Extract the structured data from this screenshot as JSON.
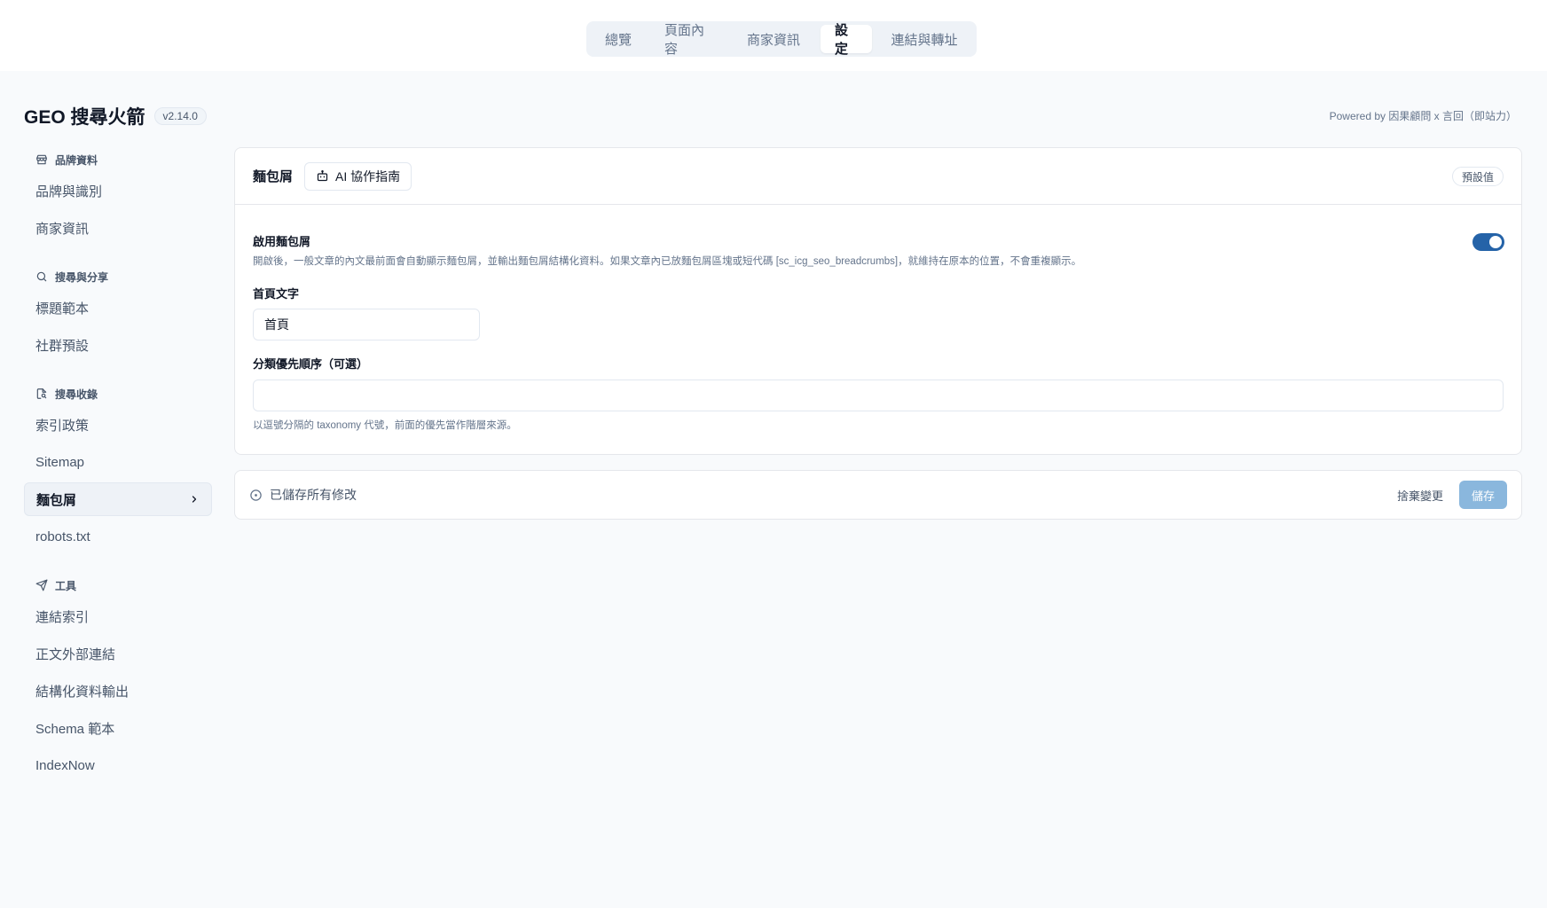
{
  "top_tabs": [
    {
      "label": "總覽"
    },
    {
      "label": "頁面內容"
    },
    {
      "label": "商家資訊"
    },
    {
      "label": "設定",
      "active": true
    },
    {
      "label": "連結與轉址"
    }
  ],
  "app": {
    "title": "GEO 搜尋火箭",
    "version": "v2.14.0",
    "powered_by": "Powered by 因果顧問 x 言回（即站力）"
  },
  "sidebar": {
    "sections": [
      {
        "heading": "品牌資料",
        "icon": "store-icon",
        "items": [
          "品牌與識別",
          "商家資訊"
        ]
      },
      {
        "heading": "搜尋與分享",
        "icon": "search-icon",
        "items": [
          "標題範本",
          "社群預設"
        ]
      },
      {
        "heading": "搜尋收錄",
        "icon": "file-search-icon",
        "items": [
          "索引政策",
          "Sitemap",
          "麵包屑",
          "robots.txt"
        ],
        "active_item": "麵包屑"
      },
      {
        "heading": "工具",
        "icon": "send-icon",
        "items": [
          "連結索引",
          "正文外部連結",
          "結構化資料輸出",
          "Schema 範本",
          "IndexNow"
        ]
      }
    ]
  },
  "panel": {
    "title": "麵包屑",
    "ai_guide_label": "AI 協作指南",
    "default_label": "預設值",
    "enable": {
      "label": "啟用麵包屑",
      "help": "開啟後，一般文章的內文最前面會自動顯示麵包屑，並輸出麵包屑結構化資料。如果文章內已放麵包屑區塊或短代碼 [sc_icg_seo_breadcrumbs]，就維持在原本的位置，不會重複顯示。",
      "on": true
    },
    "home_text": {
      "label": "首頁文字",
      "value": "首頁"
    },
    "taxonomy": {
      "label": "分類優先順序（可選）",
      "value": "",
      "help": "以逗號分隔的 taxonomy 代號，前面的優先當作階層來源。"
    }
  },
  "savebar": {
    "status": "已儲存所有修改",
    "discard_label": "捨棄變更",
    "save_label": "儲存"
  },
  "colors": {
    "accent": "#2563a8",
    "save_disabled": "#8ab7dd"
  }
}
